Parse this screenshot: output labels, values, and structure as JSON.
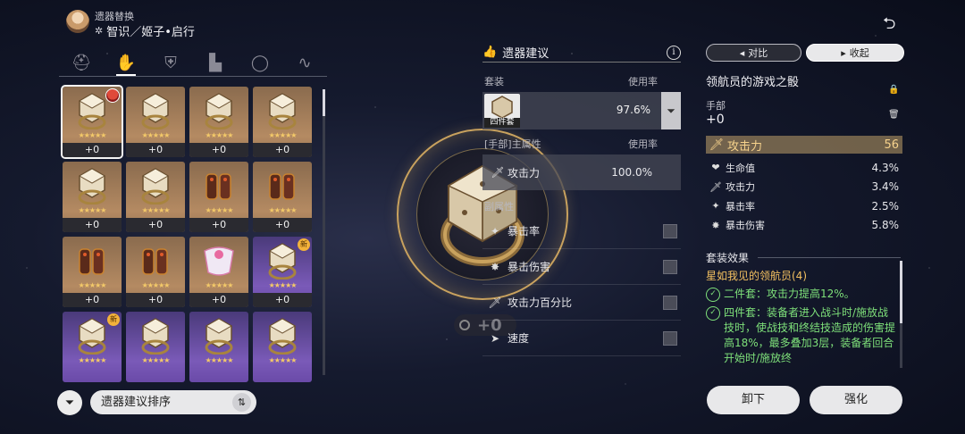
{
  "header": {
    "subtitle": "遗器替换",
    "title_icon": "智",
    "character_path": "智识／姬子•启行"
  },
  "category_tabs": [
    {
      "name": "head",
      "glyph": "⛑",
      "active": false
    },
    {
      "name": "hands",
      "glyph": "✋",
      "active": true
    },
    {
      "name": "body",
      "glyph": "👕",
      "active": false
    },
    {
      "name": "feet",
      "glyph": "👢",
      "active": false
    },
    {
      "name": "sphere",
      "glyph": "◯",
      "active": false
    },
    {
      "name": "rope",
      "glyph": "∿",
      "active": false
    }
  ],
  "relic_grid": [
    {
      "type": "ring",
      "rarity": "gold",
      "level": "+0",
      "badge": "char",
      "selected": true
    },
    {
      "type": "ring",
      "rarity": "gold",
      "level": "+0"
    },
    {
      "type": "ring",
      "rarity": "gold",
      "level": "+0"
    },
    {
      "type": "ring",
      "rarity": "gold",
      "level": "+0"
    },
    {
      "type": "ring",
      "rarity": "gold",
      "level": "+0"
    },
    {
      "type": "ring",
      "rarity": "gold",
      "level": "+0"
    },
    {
      "type": "glove",
      "rarity": "gold",
      "level": "+0"
    },
    {
      "type": "glove",
      "rarity": "gold",
      "level": "+0"
    },
    {
      "type": "glove",
      "rarity": "gold",
      "level": "+0"
    },
    {
      "type": "glove",
      "rarity": "gold",
      "level": "+0"
    },
    {
      "type": "pink",
      "rarity": "gold",
      "level": "+0"
    },
    {
      "type": "ring",
      "rarity": "purple",
      "level": "+0",
      "badge": "new"
    },
    {
      "type": "ring",
      "rarity": "purple",
      "level": "",
      "badge": "new"
    },
    {
      "type": "ring",
      "rarity": "purple",
      "level": ""
    },
    {
      "type": "ring",
      "rarity": "purple",
      "level": ""
    },
    {
      "type": "ring",
      "rarity": "purple",
      "level": ""
    }
  ],
  "new_badge_text": "新",
  "star_text": "★★★★★",
  "sort": {
    "label": "遗器建议排序",
    "icon": "⇅"
  },
  "big_relic": {
    "level": "+0"
  },
  "recommendation": {
    "title": "遗器建议",
    "info_icon": "i",
    "set_label": "套装",
    "usage_label": "使用率",
    "set_caption": "四件套",
    "set_usage": "97.6%",
    "main_label": "[手部]主属性",
    "main_usage_label": "使用率",
    "main_stat": {
      "name": "攻击力",
      "usage": "100.0%"
    },
    "sub_label": "副属性",
    "sub_stats": [
      "暴击率",
      "暴击伤害",
      "攻击力百分比",
      "速度"
    ]
  },
  "detail": {
    "compare_label": "对比",
    "collapse_label": "收起",
    "relic_name": "领航员的游戏之骰",
    "slot": "手部",
    "level": "+0",
    "main_stat": {
      "name": "攻击力",
      "value": "56"
    },
    "sub_stats": [
      {
        "name": "生命值",
        "value": "4.3%",
        "icon": "heart-icon"
      },
      {
        "name": "攻击力",
        "value": "3.4%",
        "icon": "sword-icon"
      },
      {
        "name": "暴击率",
        "value": "2.5%",
        "icon": "crit-rate-icon"
      },
      {
        "name": "暴击伤害",
        "value": "5.8%",
        "icon": "crit-dmg-icon"
      }
    ],
    "set_effect_title": "套装效果",
    "set_name": "星如我见的领航员(4)",
    "effect_2pc": "二件套：攻击力提高12%。",
    "effect_4pc": "四件套：装备者进入战斗时/施放战技时，使战技和终结技造成的伤害提高18%，最多叠加3层，装备者回合开始时/施放终",
    "unequip_label": "卸下",
    "enhance_label": "强化"
  },
  "colors": {
    "accent_gold": "#f3c060",
    "effect_green": "#7ee07a"
  }
}
